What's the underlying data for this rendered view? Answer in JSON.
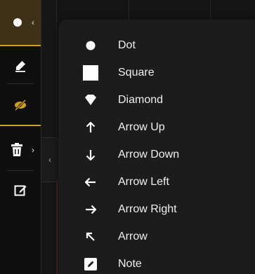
{
  "toolbar": {
    "tools": [
      {
        "name": "marker-shape-tool",
        "icon": "dot-icon",
        "expand": "‹",
        "active": true
      },
      {
        "name": "drawing-tool",
        "icon": "pen-icon",
        "active": false
      },
      {
        "name": "hide-drawings-tool",
        "icon": "eye-slash-icon",
        "active": false,
        "color": "#d4a017"
      },
      {
        "name": "delete-drawings-tool",
        "icon": "trash-icon",
        "expand": "›",
        "active": false
      },
      {
        "name": "object-tree-tool",
        "icon": "edit-square-icon",
        "active": false
      }
    ]
  },
  "collapse_tab": {
    "glyph": "‹"
  },
  "menu": {
    "items": [
      {
        "label": "Dot",
        "icon": "dot-icon"
      },
      {
        "label": "Square",
        "icon": "square-icon"
      },
      {
        "label": "Diamond",
        "icon": "diamond-icon"
      },
      {
        "label": "Arrow Up",
        "icon": "arrow-up-icon"
      },
      {
        "label": "Arrow Down",
        "icon": "arrow-down-icon"
      },
      {
        "label": "Arrow Left",
        "icon": "arrow-left-icon"
      },
      {
        "label": "Arrow Right",
        "icon": "arrow-right-icon"
      },
      {
        "label": "Arrow",
        "icon": "arrow-diagonal-icon"
      },
      {
        "label": "Note",
        "icon": "note-icon"
      }
    ]
  },
  "colors": {
    "accent": "#c9a227",
    "eye_slash": "#d4a017",
    "text": "#f0f0f0"
  }
}
